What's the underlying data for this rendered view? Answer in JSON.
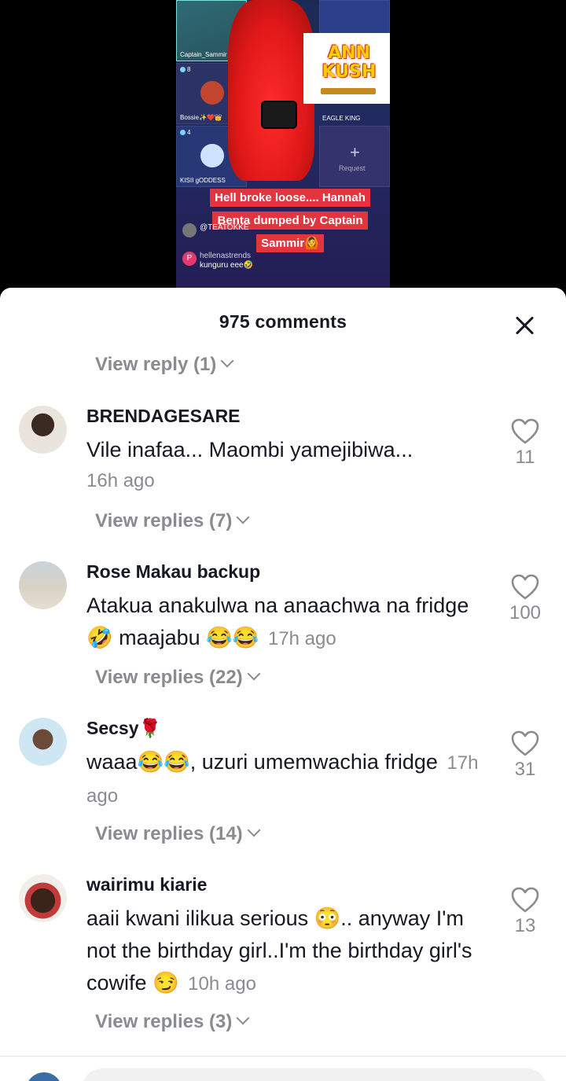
{
  "video": {
    "tiles": [
      {
        "name": "Captain_Sammir",
        "count": ""
      },
      {
        "name": "Bossie✨❤️👑",
        "count": "8"
      },
      {
        "name": "KISII gODDESS",
        "count": "4"
      },
      {
        "name": "EAGLE KING",
        "count": ""
      }
    ],
    "request_label": "Request",
    "logo_text": "ANN KUSH",
    "caption": "Hell broke loose.... Hannah Benta dumped by Captain Sammir🙆",
    "chat": [
      {
        "user": "@TEATOKKE",
        "text": ""
      },
      {
        "user": "hellenastrends",
        "text": "kunguru eee🤣",
        "initial": "P"
      }
    ]
  },
  "sheet": {
    "title": "975 comments",
    "top_view_reply": "View reply (1)",
    "comments": [
      {
        "username": "BRENDAGESARE",
        "text": "Vile inafaa... Maombi yamejibiwa...",
        "time": "16h ago",
        "likes": "11",
        "view_replies": "View replies (7)"
      },
      {
        "username": "Rose Makau backup",
        "text": "Atakua anakulwa na anaachwa na fridge 🤣 maajabu 😂😂",
        "time": "17h ago",
        "likes": "100",
        "view_replies": "View replies (22)"
      },
      {
        "username": "Secsy🌹",
        "text": "waaa😂😂, uzuri umemwachia fridge",
        "time": "17h ago",
        "likes": "31",
        "view_replies": "View replies (14)"
      },
      {
        "username": "wairimu kiarie",
        "text": "aaii kwani ilikua serious 😳.. anyway I'm not the birthday girl..I'm the birthday girl's cowife 😏",
        "time": "10h ago",
        "likes": "13",
        "view_replies": "View replies (3)"
      }
    ]
  },
  "colors": {
    "caption_bg": "#e2353d",
    "muted_text": "#8a8b91",
    "primary_text": "#161823"
  },
  "icons": [
    "close-icon",
    "heart-icon",
    "chevron-down-icon"
  ]
}
